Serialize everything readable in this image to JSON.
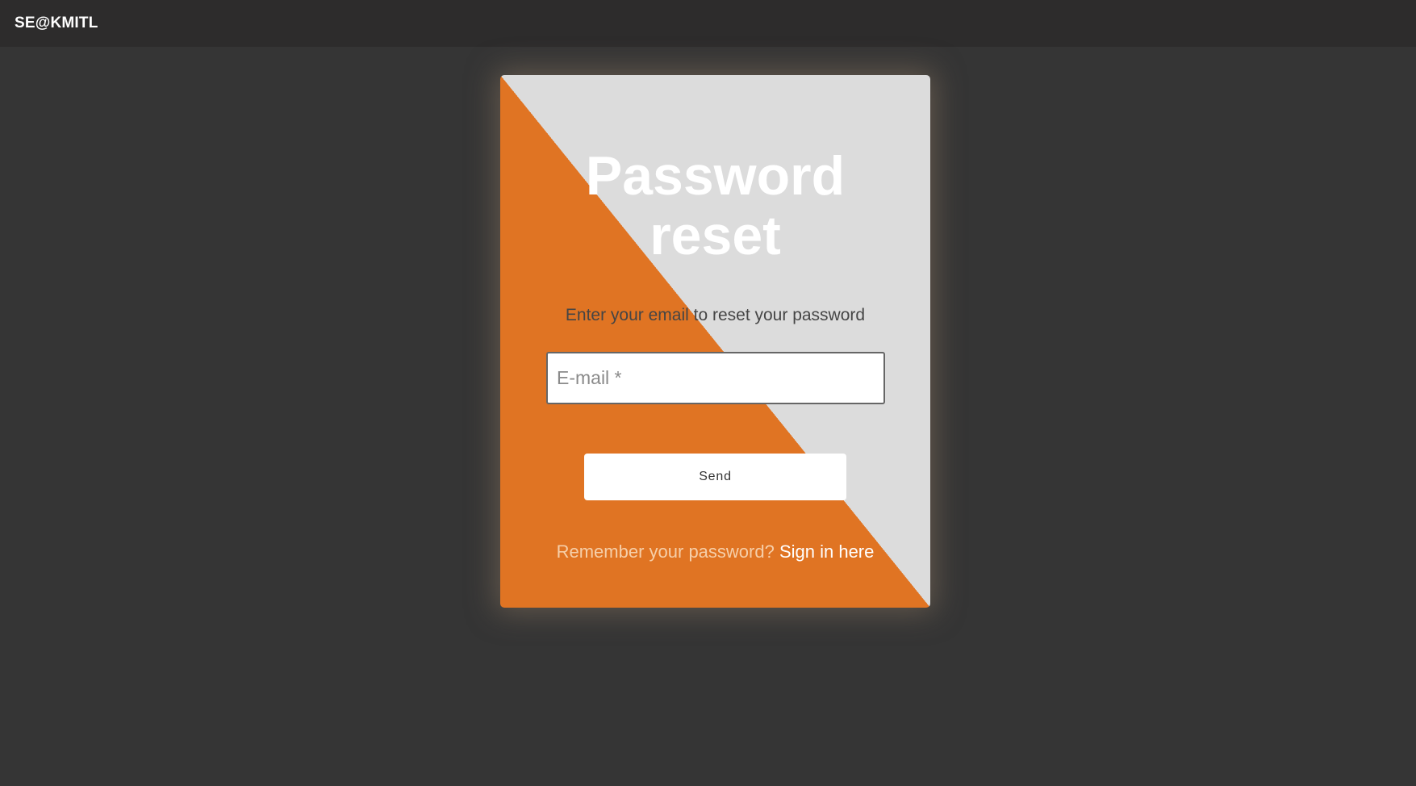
{
  "header": {
    "brand": "SE@KMITL"
  },
  "card": {
    "title_line1": "Password",
    "title_line2": "reset",
    "subtitle": "Enter your email to reset your password",
    "email_placeholder": "E-mail *",
    "email_value": "",
    "send_label": "Send",
    "remember_prompt": "Remember your password?",
    "signin_link": "Sign in here"
  },
  "colors": {
    "page_background": "#353535",
    "topbar": "#2d2c2c",
    "accent_orange": "#e07423",
    "card_light": "#dcdcdc"
  }
}
